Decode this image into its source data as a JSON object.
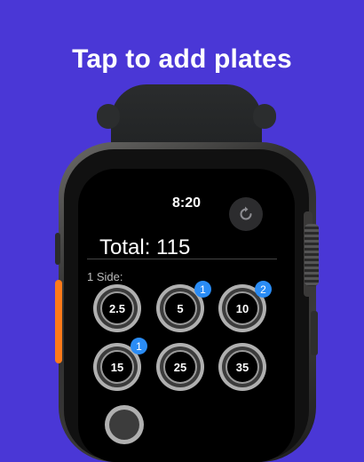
{
  "headline": "Tap to add plates",
  "watch": {
    "time": "8:20",
    "reset_icon": "arrow-clockwise-icon",
    "total_text": "Total: 115",
    "side_label": "1 Side:",
    "plates": [
      {
        "label": "2.5",
        "count": ""
      },
      {
        "label": "5",
        "count": "1"
      },
      {
        "label": "10",
        "count": "2"
      },
      {
        "label": "15",
        "count": "1"
      },
      {
        "label": "25",
        "count": ""
      },
      {
        "label": "35",
        "count": ""
      }
    ]
  },
  "colors": {
    "background": "#4a37d6",
    "badge": "#2a8cf5",
    "action_button": "#ff7a1a"
  }
}
